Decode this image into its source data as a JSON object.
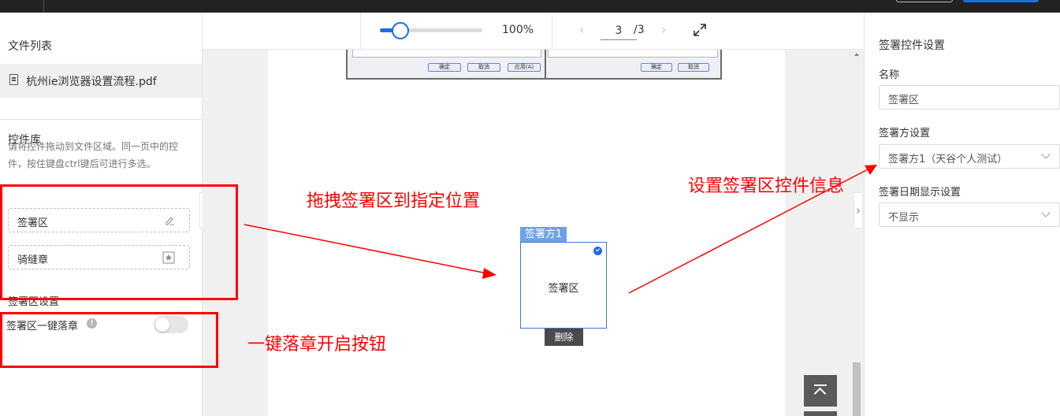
{
  "left_panel": {
    "file_list_title": "文件列表",
    "file_name": "杭州ie浏览器设置流程.pdf",
    "library_title": "控件库",
    "library_description": "请将控件拖动到文件区域。同一页中的控件，按住键盘ctrl键后可进行多选。",
    "controls": [
      {
        "label": "签署区",
        "icon": "pen-icon"
      },
      {
        "label": "骑缝章",
        "icon": "seal-icon"
      }
    ],
    "settings_title": "签署区设置",
    "one_key_seal_label": "签署区一键落章",
    "one_key_seal_enabled": false
  },
  "toolbar": {
    "zoom_percent": 100,
    "zoom_label": "100%",
    "current_page": "3",
    "total_pages": "/3"
  },
  "document": {
    "embedded_buttons": [
      "确定",
      "取消",
      "应用(A)",
      "确定",
      "取消"
    ],
    "signer_tag": "签署方1",
    "signature_field_label": "签署区",
    "delete_label": "删除"
  },
  "right_panel": {
    "title": "签署控件设置",
    "name_label": "名称",
    "name_value": "签署区",
    "signer_label": "签署方设置",
    "signer_value": "签署方1（天谷个人测试）",
    "date_label": "签署日期显示设置",
    "date_value": "不显示"
  },
  "annotations": {
    "drag_hint": "拖拽签署区到指定位置",
    "set_info_hint": "设置签署区控件信息",
    "toggle_hint": "一键落章开启按钮"
  },
  "colors": {
    "accent": "#1a6fe0",
    "annotation": "#ff0000",
    "signer_tag_bg": "#6fa2e8"
  }
}
